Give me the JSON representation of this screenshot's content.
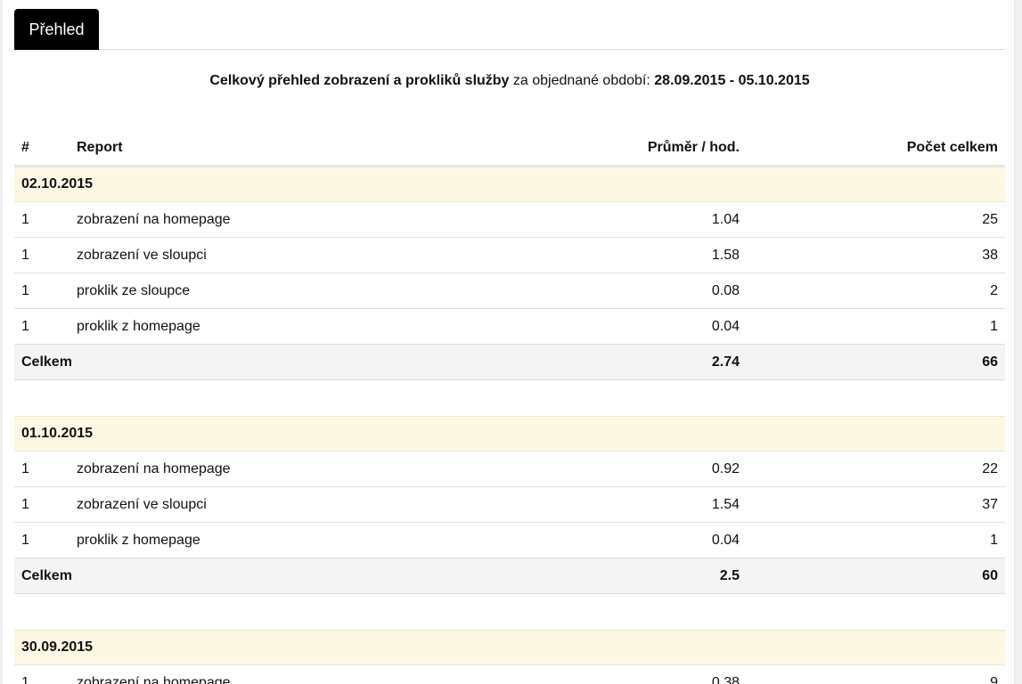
{
  "tabs": [
    {
      "label": "Přehled"
    }
  ],
  "summary": {
    "bold_prefix": "Celkový přehled zobrazení a prokliků služby",
    "middle": " za objednané období: ",
    "period": "28.09.2015 - 05.10.2015"
  },
  "table": {
    "headers": {
      "num": "#",
      "report": "Report",
      "avg": "Průměr / hod.",
      "total": "Počet celkem"
    },
    "groups": [
      {
        "date": "02.10.2015",
        "rows": [
          {
            "num": "1",
            "report": "zobrazení na homepage",
            "avg": "1.04",
            "total": "25"
          },
          {
            "num": "1",
            "report": "zobrazení ve sloupci",
            "avg": "1.58",
            "total": "38"
          },
          {
            "num": "1",
            "report": "proklik ze sloupce",
            "avg": "0.08",
            "total": "2"
          },
          {
            "num": "1",
            "report": "proklik z homepage",
            "avg": "0.04",
            "total": "1"
          }
        ],
        "total_label": "Celkem",
        "total_avg": "2.74",
        "total_count": "66"
      },
      {
        "date": "01.10.2015",
        "rows": [
          {
            "num": "1",
            "report": "zobrazení na homepage",
            "avg": "0.92",
            "total": "22"
          },
          {
            "num": "1",
            "report": "zobrazení ve sloupci",
            "avg": "1.54",
            "total": "37"
          },
          {
            "num": "1",
            "report": "proklik z homepage",
            "avg": "0.04",
            "total": "1"
          }
        ],
        "total_label": "Celkem",
        "total_avg": "2.5",
        "total_count": "60"
      },
      {
        "date": "30.09.2015",
        "rows": [
          {
            "num": "1",
            "report": "zobrazení na homepage",
            "avg": "0.38",
            "total": "9"
          }
        ]
      }
    ]
  }
}
